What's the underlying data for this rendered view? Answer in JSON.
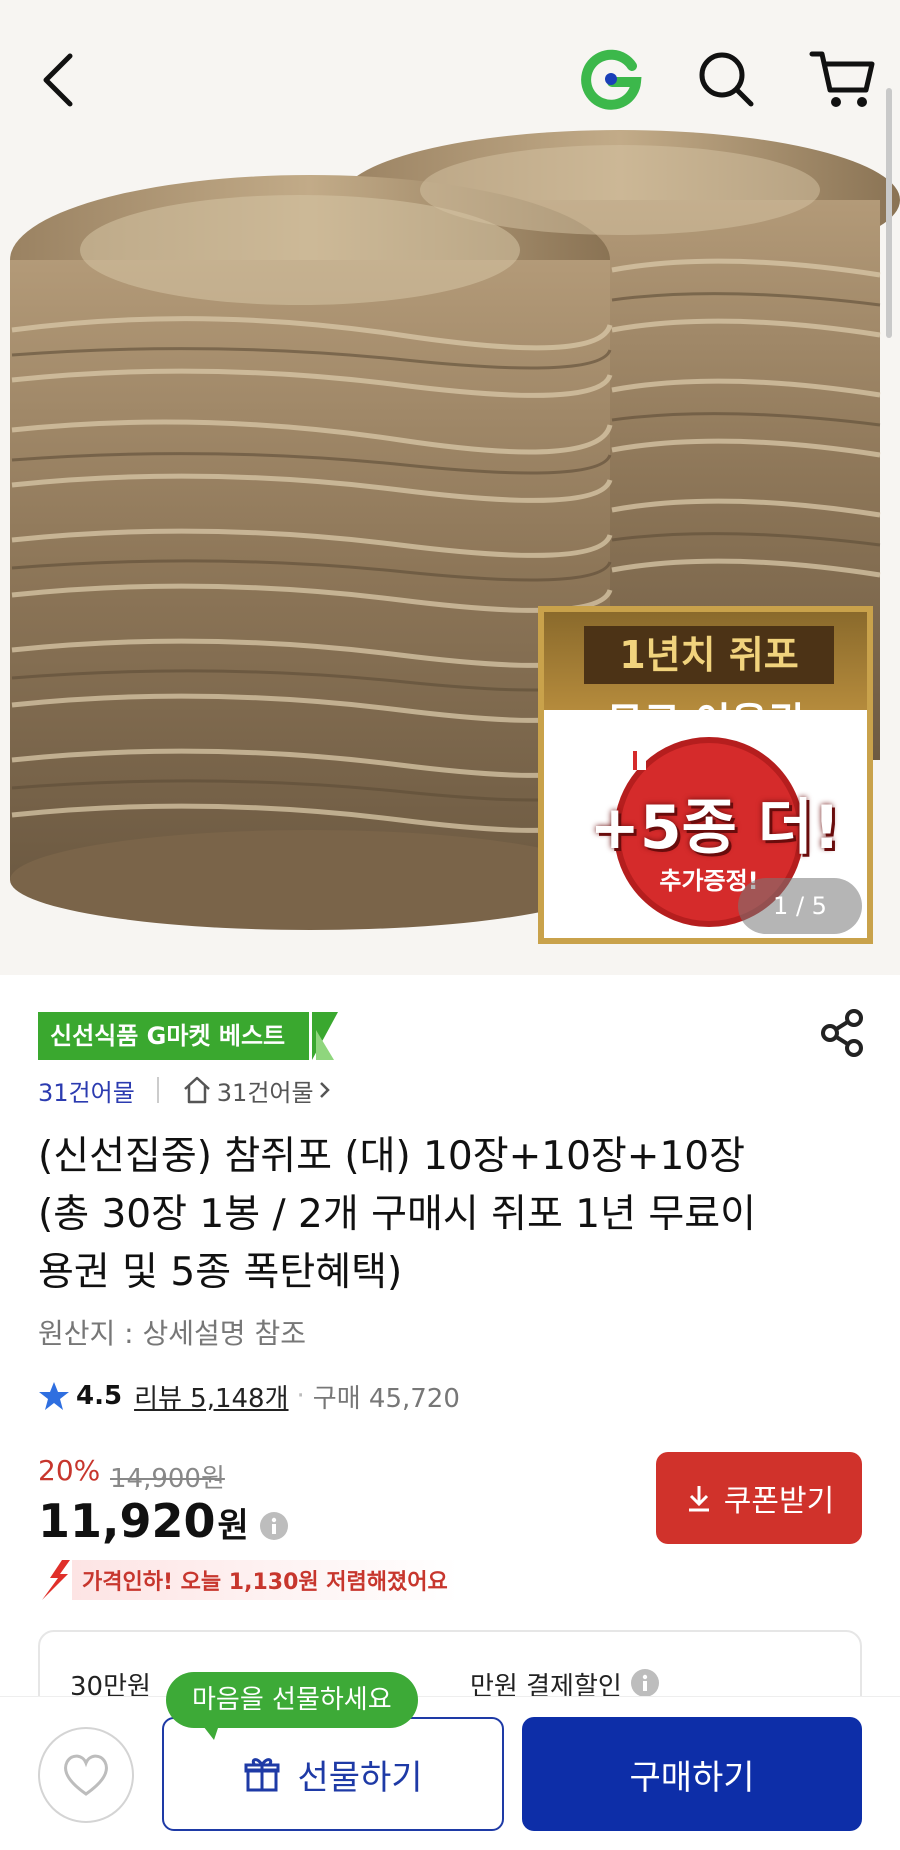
{
  "header": {
    "back_icon": "chevron-left-icon",
    "logo_icon": "g-logo-icon",
    "search_icon": "search-icon",
    "cart_icon": "cart-icon"
  },
  "hero": {
    "image_subject": "",
    "promo": {
      "line1": "1년치 쥐포",
      "line2": "무료 이용권",
      "big": "+5종 더!",
      "small": "추가증정!"
    },
    "pager": "1 / 5"
  },
  "product": {
    "badge": "신선식품 G마켓 베스트",
    "seller": "31건어물",
    "store_link": "31건어물",
    "title": "(신선집중) 참쥐포 (대) 10장+10장+10장 (총 30장 1봉 / 2개 구매시 쥐포 1년 무료이용권 및 5종 폭탄혜택)",
    "origin": "원산지 : 상세설명 참조",
    "rating": "4.5",
    "reviews": "리뷰 5,148개",
    "separator": "·",
    "purchases": "구매 45,720",
    "discount": "20%",
    "original_price": "14,900원",
    "price": "11,920",
    "price_unit": "원",
    "coupon_label": "쿠폰받기",
    "price_drop": "가격인하! 오늘 1,130원 저렴해졌어요",
    "benefit_left": "30만원",
    "benefit_right": "만원 결제할인"
  },
  "bottom": {
    "tooltip": "마음을 선물하세요",
    "gift_label": "선물하기",
    "buy_label": "구매하기"
  },
  "colors": {
    "brand_blue": "#0d2ea8",
    "coupon_red": "#d0322b",
    "badge_green": "#3aa82f",
    "discount_red": "#c7362d"
  }
}
